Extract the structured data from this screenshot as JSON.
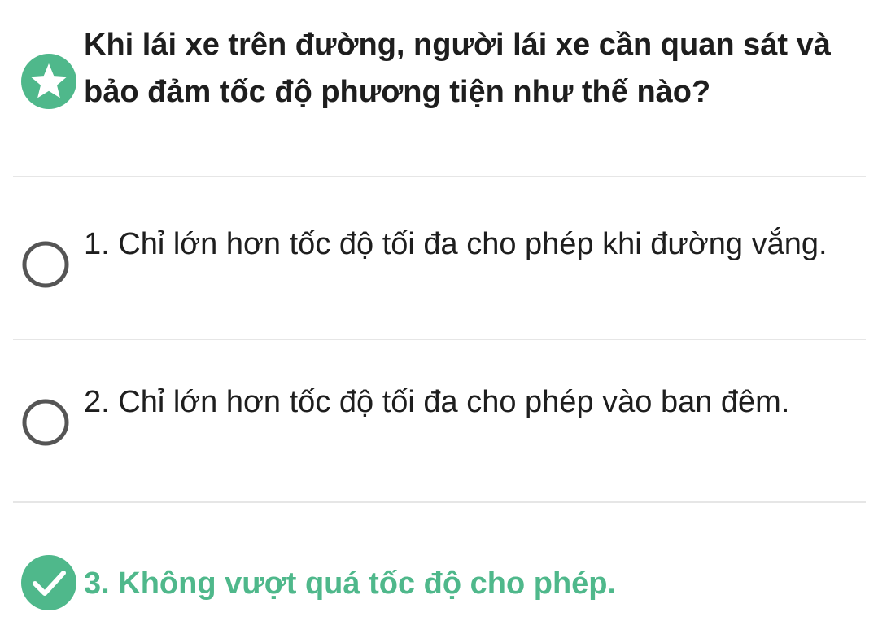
{
  "colors": {
    "accent_green": "#4fb88b",
    "text_dark": "#1e1e1e",
    "radio_gray": "#555555",
    "divider": "#e6e6e6"
  },
  "question": {
    "icon": "star-icon",
    "text": "Khi lái xe trên đường, người lái xe cần quan sát và bảo đảm tốc độ phương tiện như thế nào?"
  },
  "options": [
    {
      "text": "1. Chỉ lớn hơn tốc độ tối đa cho phép khi đường vắng.",
      "state": "unselected",
      "icon": "radio-empty-icon"
    },
    {
      "text": "2. Chỉ lớn hơn tốc độ tối đa cho phép vào ban đêm.",
      "state": "unselected",
      "icon": "radio-empty-icon"
    },
    {
      "text": "3. Không vượt quá tốc độ cho phép.",
      "state": "correct",
      "icon": "check-circle-icon"
    }
  ]
}
